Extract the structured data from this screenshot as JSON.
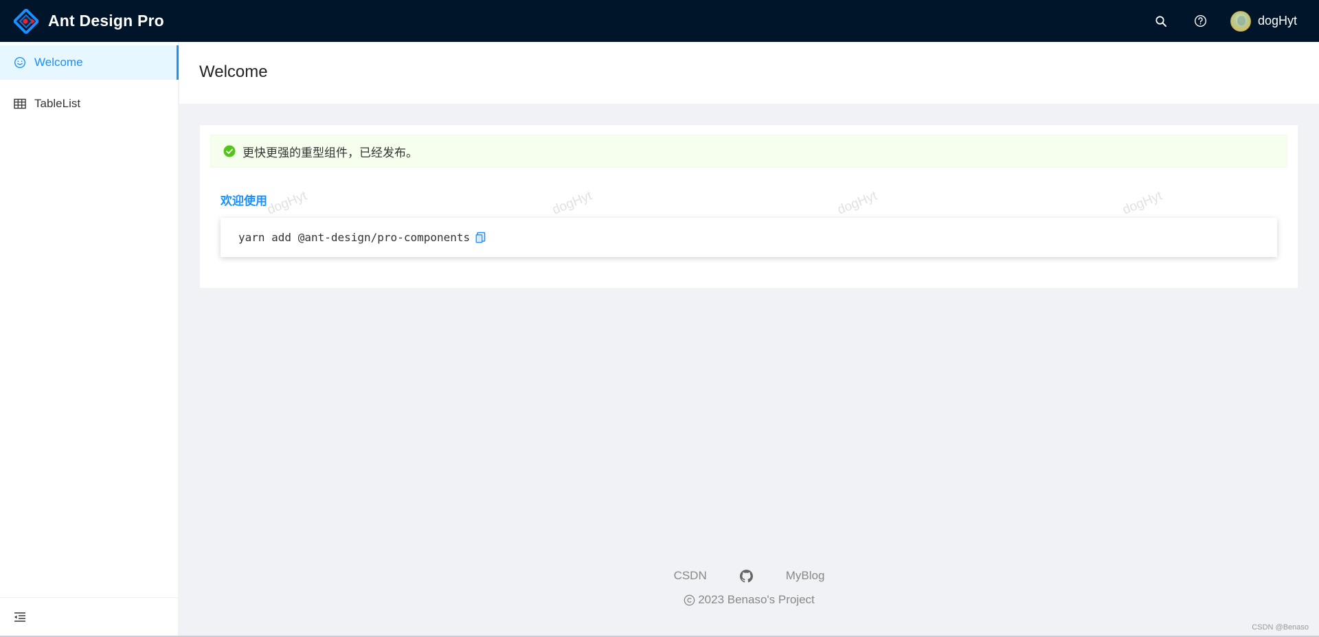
{
  "header": {
    "app_title": "Ant Design Pro",
    "username": "dogHyt",
    "icons": [
      "search-icon",
      "question-circle-icon"
    ]
  },
  "sidebar": {
    "items": [
      {
        "label": "Welcome",
        "icon": "smile-icon",
        "active": true
      },
      {
        "label": "TableList",
        "icon": "table-icon",
        "active": false
      }
    ],
    "collapse_icon": "menu-fold-icon"
  },
  "page": {
    "title": "Welcome"
  },
  "card": {
    "alert_text": "更快更强的重型组件，已经发布。",
    "welcome_heading": "欢迎使用",
    "code_text": "yarn add @ant-design/pro-components"
  },
  "watermark": {
    "text": "dogHyt"
  },
  "footer": {
    "links": [
      "CSDN",
      "MyBlog"
    ],
    "copyright": "2023 Benaso's Project"
  },
  "credit": "CSDN @Benaso",
  "colors": {
    "header_bg": "#001529",
    "accent": "#1890ff",
    "alert_bg": "#f6ffed",
    "success": "#52c41a"
  }
}
